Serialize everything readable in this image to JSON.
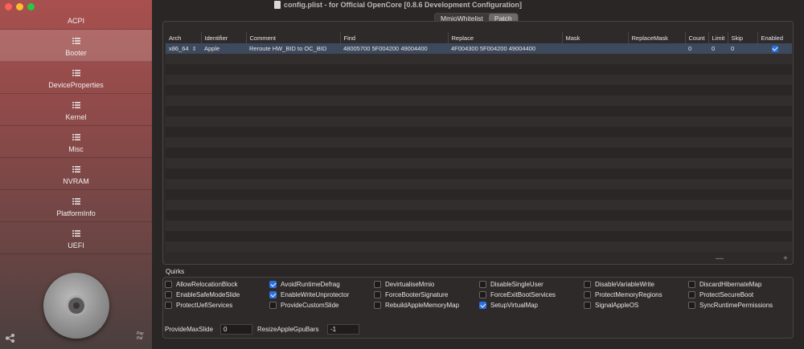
{
  "window": {
    "title": "config.plist - for Official OpenCore [0.8.6 Development Configuration]"
  },
  "sidebar": {
    "items": [
      {
        "label": "ACPI"
      },
      {
        "label": "Booter"
      },
      {
        "label": "DeviceProperties"
      },
      {
        "label": "Kernel"
      },
      {
        "label": "Misc"
      },
      {
        "label": "NVRAM"
      },
      {
        "label": "PlatformInfo"
      },
      {
        "label": "UEFI"
      }
    ],
    "active": "Booter",
    "footer_text": "Pay\nPal"
  },
  "tabs": [
    {
      "label": "MmioWhitelist"
    },
    {
      "label": "Patch"
    }
  ],
  "active_tab": "Patch",
  "table": {
    "columns": [
      "Arch",
      "Identifier",
      "Comment",
      "Find",
      "Replace",
      "Mask",
      "ReplaceMask",
      "Count",
      "Limit",
      "Skip",
      "Enabled"
    ],
    "rows": [
      {
        "arch": "x86_64",
        "identifier": "Apple",
        "comment": "Reroute HW_BID to OC_BID",
        "find": "48005700 5F004200 49004400",
        "replace": "4F004300 5F004200 49004400",
        "mask": "",
        "replace_mask": "",
        "count": "0",
        "limit": "0",
        "skip": "0",
        "enabled": true
      }
    ],
    "minus_label": "—",
    "plus_label": "+"
  },
  "quirks": {
    "title": "Quirks",
    "items": [
      {
        "label": "AllowRelocationBlock",
        "checked": false
      },
      {
        "label": "AvoidRuntimeDefrag",
        "checked": true
      },
      {
        "label": "DevirtualiseMmio",
        "checked": false
      },
      {
        "label": "DisableSingleUser",
        "checked": false
      },
      {
        "label": "DisableVariableWrite",
        "checked": false
      },
      {
        "label": "DiscardHibernateMap",
        "checked": false
      },
      {
        "label": "EnableSafeModeSlide",
        "checked": false
      },
      {
        "label": "EnableWriteUnprotector",
        "checked": true
      },
      {
        "label": "ForceBooterSignature",
        "checked": false
      },
      {
        "label": "ForceExitBootServices",
        "checked": false
      },
      {
        "label": "ProtectMemoryRegions",
        "checked": false
      },
      {
        "label": "ProtectSecureBoot",
        "checked": false
      },
      {
        "label": "ProtectUefiServices",
        "checked": false
      },
      {
        "label": "ProvideCustomSlide",
        "checked": false
      },
      {
        "label": "RebuildAppleMemoryMap",
        "checked": false
      },
      {
        "label": "SetupVirtualMap",
        "checked": true
      },
      {
        "label": "SignalAppleOS",
        "checked": false
      },
      {
        "label": "SyncRuntimePermissions",
        "checked": false
      }
    ]
  },
  "fields": {
    "provide_max_slide": {
      "label": "ProvideMaxSlide",
      "value": "0"
    },
    "resize_gpu_bars": {
      "label": "ResizeAppleGpuBars",
      "value": "-1"
    }
  },
  "colors": {
    "accent": "#2a71e0",
    "selected_row": "#3d4a5e",
    "sidebar_top": "#a8504f"
  }
}
